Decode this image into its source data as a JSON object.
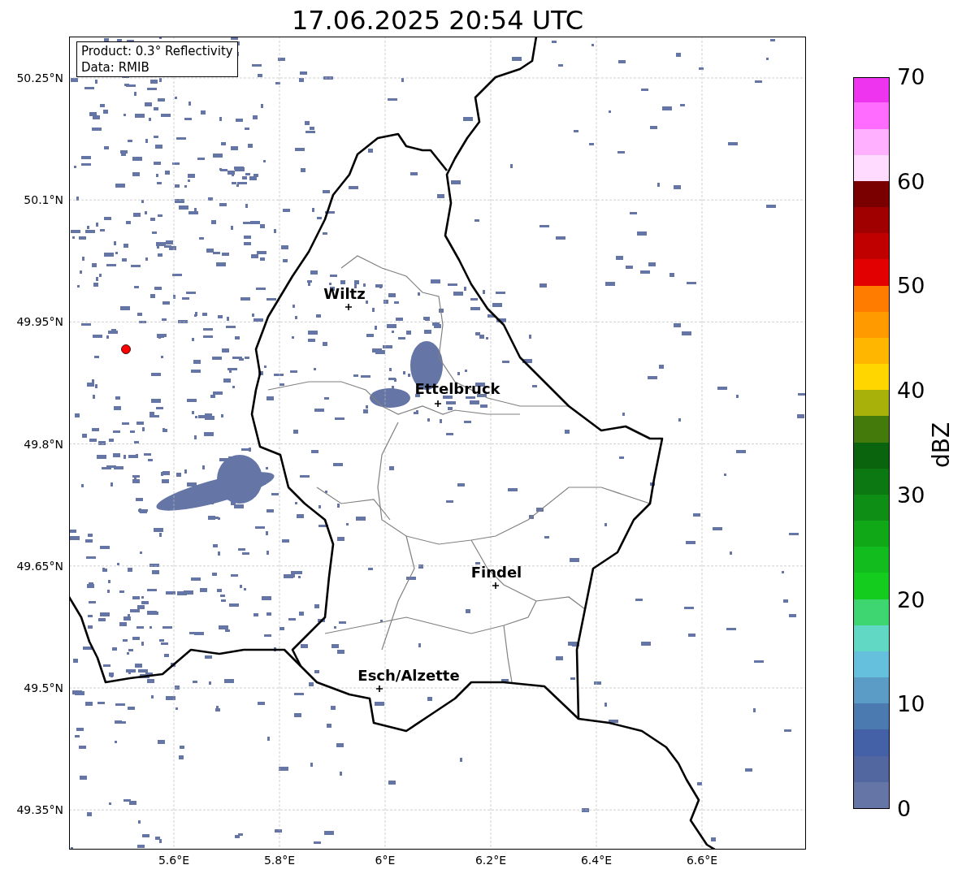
{
  "title": "17.06.2025 20:54 UTC",
  "info_box": [
    "Product: 0.3° Reflectivity",
    "Data: RMIB"
  ],
  "y_tick_labels": [
    "50.25°N",
    "50.1°N",
    "49.95°N",
    "49.8°N",
    "49.65°N",
    "49.5°N",
    "49.35°N"
  ],
  "x_tick_labels": [
    "5.6°E",
    "5.8°E",
    "6°E",
    "6.2°E",
    "6.4°E",
    "6.6°E"
  ],
  "cities": [
    {
      "name": "Wiltz"
    },
    {
      "name": "Ettelbruck"
    },
    {
      "name": "Findel"
    },
    {
      "name": "Esch/Alzette"
    }
  ],
  "colorbar": {
    "label": "dBZ",
    "tick_labels": [
      "70",
      "60",
      "50",
      "40",
      "30",
      "20",
      "10",
      "0"
    ],
    "segments": [
      {
        "color": "#6475a6"
      },
      {
        "color": "#5266a0"
      },
      {
        "color": "#4460a6"
      },
      {
        "color": "#4a7ab0"
      },
      {
        "color": "#5a9cc6"
      },
      {
        "color": "#64c0dc"
      },
      {
        "color": "#60d8c4"
      },
      {
        "color": "#3ed670"
      },
      {
        "color": "#14cc1e"
      },
      {
        "color": "#12bc1e"
      },
      {
        "color": "#10a816"
      },
      {
        "color": "#0e8e14"
      },
      {
        "color": "#0c7812"
      },
      {
        "color": "#0a640e"
      },
      {
        "color": "#447a0c"
      },
      {
        "color": "#a8b00a"
      },
      {
        "color": "#ffd600"
      },
      {
        "color": "#ffb600"
      },
      {
        "color": "#ff9a00"
      },
      {
        "color": "#ff7c00"
      },
      {
        "color": "#e20000"
      },
      {
        "color": "#c00000"
      },
      {
        "color": "#a00000"
      },
      {
        "color": "#7a0000"
      },
      {
        "color": "#ffdcff"
      },
      {
        "color": "#ffb0ff"
      },
      {
        "color": "#ff6cff"
      },
      {
        "color": "#ee34ee"
      }
    ]
  }
}
